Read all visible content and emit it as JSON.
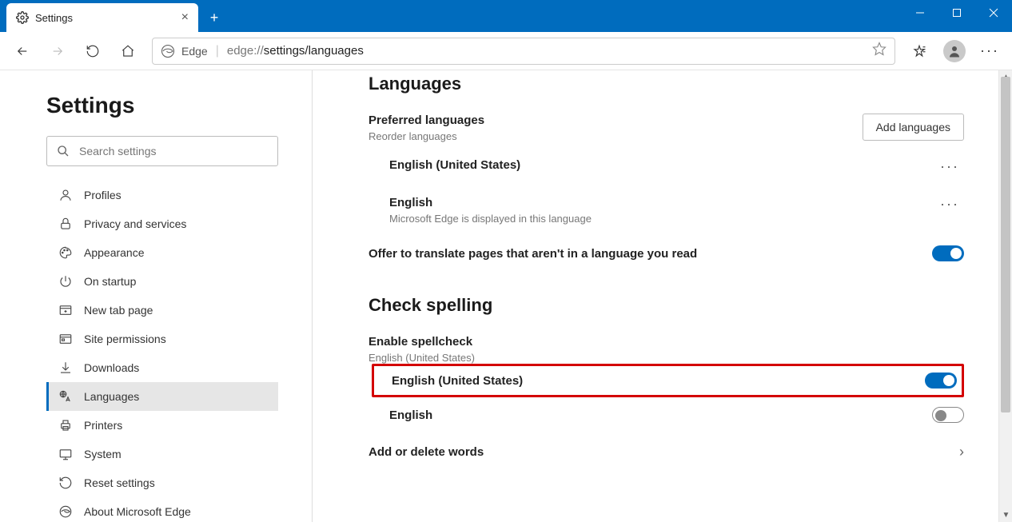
{
  "tab": {
    "title": "Settings"
  },
  "address": {
    "appLabel": "Edge",
    "urlPlain": "edge://",
    "urlDark": "settings/languages"
  },
  "sidebar": {
    "title": "Settings",
    "searchPlaceholder": "Search settings",
    "items": [
      {
        "label": "Profiles"
      },
      {
        "label": "Privacy and services"
      },
      {
        "label": "Appearance"
      },
      {
        "label": "On startup"
      },
      {
        "label": "New tab page"
      },
      {
        "label": "Site permissions"
      },
      {
        "label": "Downloads"
      },
      {
        "label": "Languages"
      },
      {
        "label": "Printers"
      },
      {
        "label": "System"
      },
      {
        "label": "Reset settings"
      },
      {
        "label": "About Microsoft Edge"
      }
    ]
  },
  "content": {
    "languagesHeading": "Languages",
    "preferred": {
      "title": "Preferred languages",
      "hint": "Reorder languages",
      "addBtn": "Add languages"
    },
    "langList": [
      {
        "name": "English (United States)",
        "sub": ""
      },
      {
        "name": "English",
        "sub": "Microsoft Edge is displayed in this language"
      }
    ],
    "translate": {
      "label": "Offer to translate pages that aren't in a language you read",
      "on": true
    },
    "spelling": {
      "heading": "Check spelling",
      "enable": {
        "title": "Enable spellcheck",
        "hint": "English (United States)"
      },
      "items": [
        {
          "name": "English (United States)",
          "on": true
        },
        {
          "name": "English",
          "on": false
        }
      ],
      "addDelete": "Add or delete words"
    }
  }
}
